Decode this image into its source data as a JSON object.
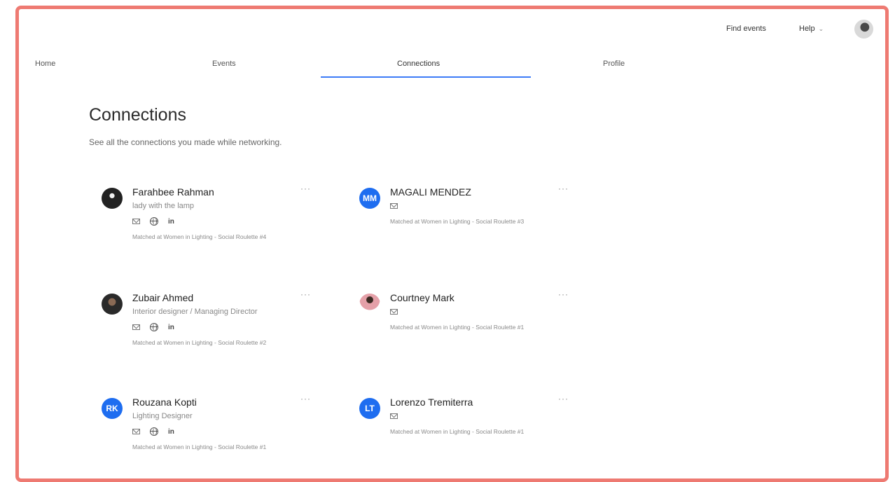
{
  "header": {
    "find_events": "Find events",
    "help": "Help",
    "help_chevron": "⌄"
  },
  "nav": {
    "tabs": [
      {
        "label": "Home"
      },
      {
        "label": "Events"
      },
      {
        "label": "Connections",
        "active": true
      },
      {
        "label": "Profile"
      }
    ]
  },
  "page": {
    "title": "Connections",
    "subtitle": "See all the connections you made while networking."
  },
  "colors": {
    "accent": "#3d7bf7",
    "avatar_initials_bg": "#1e6df0",
    "frame_border": "#ee7a72"
  },
  "connections": [
    {
      "name": "Farahbee Rahman",
      "role": "lady with the lamp",
      "icons": [
        "mail-icon",
        "globe-icon",
        "linkedin-icon"
      ],
      "linkedin_label": "in",
      "matched": "Matched at Women in Lighting - Social Roulette #4"
    },
    {
      "name": "MAGALI MENDEZ",
      "initials": "MM",
      "icons": [
        "mail-icon"
      ],
      "matched": "Matched at Women in Lighting - Social Roulette #3"
    },
    {
      "name": "Zubair Ahmed",
      "role": "Interior designer / Managing Director",
      "icons": [
        "mail-icon",
        "globe-icon",
        "linkedin-icon"
      ],
      "linkedin_label": "in",
      "matched": "Matched at Women in Lighting - Social Roulette #2"
    },
    {
      "name": "Courtney Mark",
      "icons": [
        "mail-icon"
      ],
      "matched": "Matched at Women in Lighting - Social Roulette #1"
    },
    {
      "name": "Rouzana Kopti",
      "initials": "RK",
      "role": "Lighting Designer",
      "icons": [
        "mail-icon",
        "globe-icon",
        "linkedin-icon"
      ],
      "linkedin_label": "in",
      "matched": "Matched at Women in Lighting - Social Roulette #1"
    },
    {
      "name": "Lorenzo Tremiterra",
      "initials": "LT",
      "icons": [
        "mail-icon"
      ],
      "matched": "Matched at Women in Lighting - Social Roulette #1"
    }
  ],
  "more_label": "···"
}
